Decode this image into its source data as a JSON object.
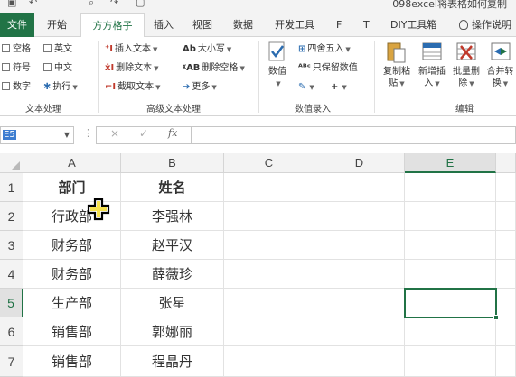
{
  "titlebar": {
    "doc_title": "098excel将表格如何复制"
  },
  "tabs": [
    {
      "label": "文件"
    },
    {
      "label": "开始"
    },
    {
      "label": "方方格子"
    },
    {
      "label": "插入"
    },
    {
      "label": "视图"
    },
    {
      "label": "数据"
    },
    {
      "label": "开发工具"
    },
    {
      "label": "F"
    },
    {
      "label": "T"
    },
    {
      "label": "DIY工具箱"
    },
    {
      "label": "操作说明"
    }
  ],
  "ribbon": {
    "text_group": {
      "items": [
        "空格",
        "英文",
        "符号",
        "中文",
        "数字",
        "执行"
      ],
      "label": "文本处理"
    },
    "adv_text_group": {
      "items": [
        "插入文本",
        "删除文本",
        "截取文本",
        "大小写",
        "删除空格",
        "更多"
      ],
      "label": "高级文本处理"
    },
    "number_group": {
      "items": [
        "数值",
        "四舍五入",
        "只保留数值"
      ],
      "label": "数值录入"
    },
    "edit_group": {
      "items": [
        {
          "line1": "复制粘",
          "line2": "贴"
        },
        {
          "line1": "新增插",
          "line2": "入"
        },
        {
          "line1": "批量删",
          "line2": "除"
        },
        {
          "line1": "合并转",
          "line2": "换"
        }
      ],
      "label": "编辑"
    }
  },
  "formula_bar": {
    "name_box": "E5",
    "cancel": "×",
    "confirm": "✓",
    "fx": "fx",
    "value": ""
  },
  "sheet": {
    "columns": [
      "A",
      "B",
      "C",
      "D",
      "E"
    ],
    "rows": [
      "1",
      "2",
      "3",
      "4",
      "5",
      "6",
      "7"
    ],
    "cells": [
      [
        "部门",
        "姓名"
      ],
      [
        "行政部",
        "李强林"
      ],
      [
        "财务部",
        "赵平汉"
      ],
      [
        "财务部",
        "薛薇珍"
      ],
      [
        "生产部",
        "张星"
      ],
      [
        "销售部",
        "郭娜丽"
      ],
      [
        "销售部",
        "程晶丹"
      ]
    ],
    "active_cell": "E5"
  },
  "colors": {
    "accent": "#217346",
    "selection": "#3d7dd0"
  }
}
